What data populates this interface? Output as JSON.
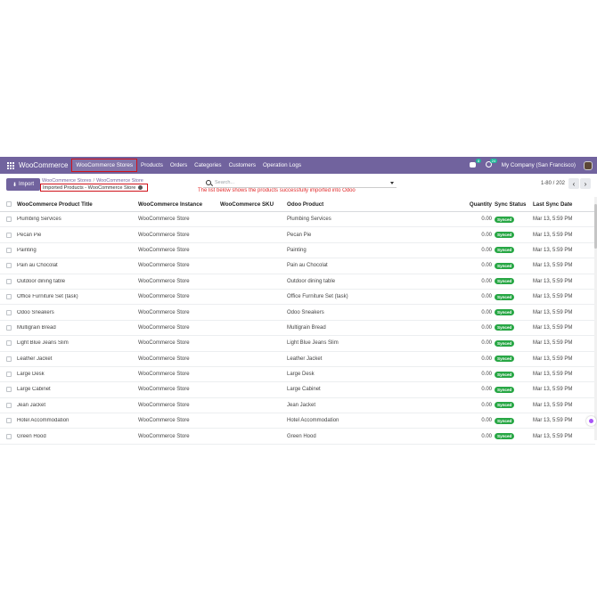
{
  "navbar": {
    "brand": "WooCommerce",
    "menu": [
      "WooCommerce Stores",
      "Products",
      "Orders",
      "Categories",
      "Customers",
      "Operation Logs"
    ],
    "active_menu": "WooCommerce Stores",
    "chat_badge": "8",
    "activity_badge": "24",
    "company": "My Company (San Francisco)",
    "icons": [
      "apps-grid-icon",
      "chat-icon",
      "clock-icon",
      "avatar"
    ]
  },
  "control": {
    "import_label": "Import",
    "breadcrumb": [
      "WooCommerce Stores",
      "WooCommerce Store"
    ],
    "breadcrumb_sep": "/",
    "current": "Imported Products - WooCommerce Store",
    "note": "The list below shows the products successfully imported into Odoo",
    "search_placeholder": "Search...",
    "pager": "1-80 / 202"
  },
  "table": {
    "headers": [
      "WooCommerce Product Title",
      "WooCommerce Instance",
      "WooCommerce SKU",
      "Odoo Product",
      "Quantity",
      "Sync Status",
      "Last Sync Date"
    ],
    "rows": [
      {
        "title": "Plumbing Services",
        "instance": "WooCommerce Store",
        "sku": "",
        "odoo": "Plumbing Services",
        "qty": "0.00",
        "status": "Synced",
        "date": "Mar 13, 5:59 PM"
      },
      {
        "title": "Pecan Pie",
        "instance": "WooCommerce Store",
        "sku": "",
        "odoo": "Pecan Pie",
        "qty": "0.00",
        "status": "Synced",
        "date": "Mar 13, 5:59 PM"
      },
      {
        "title": "Painting",
        "instance": "WooCommerce Store",
        "sku": "",
        "odoo": "Painting",
        "qty": "0.00",
        "status": "Synced",
        "date": "Mar 13, 5:59 PM"
      },
      {
        "title": "Pain au Chocolat",
        "instance": "WooCommerce Store",
        "sku": "",
        "odoo": "Pain au Chocolat",
        "qty": "0.00",
        "status": "Synced",
        "date": "Mar 13, 5:59 PM"
      },
      {
        "title": "Outdoor dining table",
        "instance": "WooCommerce Store",
        "sku": "",
        "odoo": "Outdoor dining table",
        "qty": "0.00",
        "status": "Synced",
        "date": "Mar 13, 5:59 PM"
      },
      {
        "title": "Office Furniture Set (task)",
        "instance": "WooCommerce Store",
        "sku": "",
        "odoo": "Office Furniture Set (task)",
        "qty": "0.00",
        "status": "Synced",
        "date": "Mar 13, 5:59 PM"
      },
      {
        "title": "Odoo Sneakers",
        "instance": "WooCommerce Store",
        "sku": "",
        "odoo": "Odoo Sneakers",
        "qty": "0.00",
        "status": "Synced",
        "date": "Mar 13, 5:59 PM"
      },
      {
        "title": "Multigrain Bread",
        "instance": "WooCommerce Store",
        "sku": "",
        "odoo": "Multigrain Bread",
        "qty": "0.00",
        "status": "Synced",
        "date": "Mar 13, 5:59 PM"
      },
      {
        "title": "Light Blue Jeans Slim",
        "instance": "WooCommerce Store",
        "sku": "",
        "odoo": "Light Blue Jeans Slim",
        "qty": "0.00",
        "status": "Synced",
        "date": "Mar 13, 5:59 PM"
      },
      {
        "title": "Leather Jacket",
        "instance": "WooCommerce Store",
        "sku": "",
        "odoo": "Leather Jacket",
        "qty": "0.00",
        "status": "Synced",
        "date": "Mar 13, 5:59 PM"
      },
      {
        "title": "Large Desk",
        "instance": "WooCommerce Store",
        "sku": "",
        "odoo": "Large Desk",
        "qty": "0.00",
        "status": "Synced",
        "date": "Mar 13, 5:59 PM"
      },
      {
        "title": "Large Cabinet",
        "instance": "WooCommerce Store",
        "sku": "",
        "odoo": "Large Cabinet",
        "qty": "0.00",
        "status": "Synced",
        "date": "Mar 13, 5:59 PM"
      },
      {
        "title": "Jean Jacket",
        "instance": "WooCommerce Store",
        "sku": "",
        "odoo": "Jean Jacket",
        "qty": "0.00",
        "status": "Synced",
        "date": "Mar 13, 5:59 PM"
      },
      {
        "title": "Hotel Accommodation",
        "instance": "WooCommerce Store",
        "sku": "",
        "odoo": "Hotel Accommodation",
        "qty": "0.00",
        "status": "Synced",
        "date": "Mar 13, 5:59 PM"
      },
      {
        "title": "Green Hood",
        "instance": "WooCommerce Store",
        "sku": "",
        "odoo": "Green Hood",
        "qty": "0.00",
        "status": "Synced",
        "date": "Mar 13, 5:59 PM"
      }
    ]
  },
  "colors": {
    "navbar": "#71639e",
    "synced": "#28a745",
    "highlight": "#d0121b"
  }
}
